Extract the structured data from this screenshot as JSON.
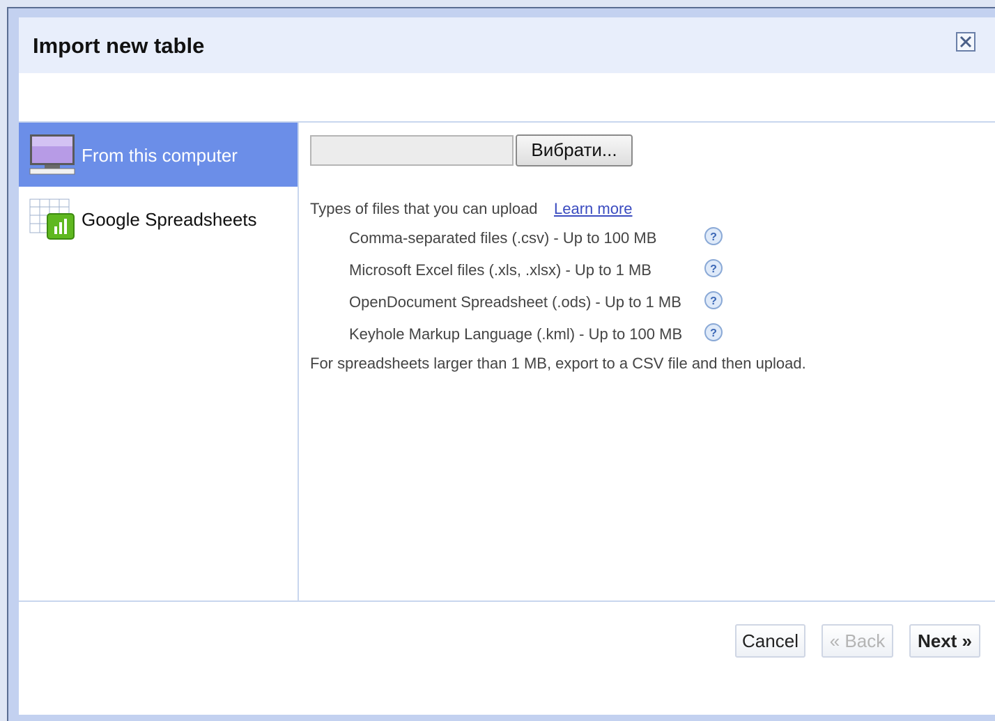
{
  "dialog": {
    "title": "Import new table"
  },
  "sidebar": {
    "items": [
      {
        "label": "From this computer",
        "icon": "monitor-icon",
        "selected": true
      },
      {
        "label": "Google Spreadsheets",
        "icon": "spreadsheet-icon",
        "selected": false
      }
    ]
  },
  "upload": {
    "file_value": "",
    "browse_label": "Вибрати..."
  },
  "types": {
    "heading": "Types of files that you can upload",
    "learn_more": "Learn more",
    "items": [
      {
        "label": "Comma-separated files (.csv) - Up to 100 MB"
      },
      {
        "label": "Microsoft Excel files (.xls, .xlsx) - Up to 1 MB"
      },
      {
        "label": "OpenDocument Spreadsheet (.ods) - Up to 1 MB"
      },
      {
        "label": "Keyhole Markup Language (.kml) - Up to 100 MB"
      }
    ],
    "note": "For spreadsheets larger than 1 MB, export to a CSV file and then upload."
  },
  "footer": {
    "cancel_label": "Cancel",
    "back_label": "« Back",
    "next_label": "Next »"
  },
  "colors": {
    "selected_item": "#6b8ee8",
    "titlebar": "#e8eefb",
    "link": "#3b4cc0"
  }
}
